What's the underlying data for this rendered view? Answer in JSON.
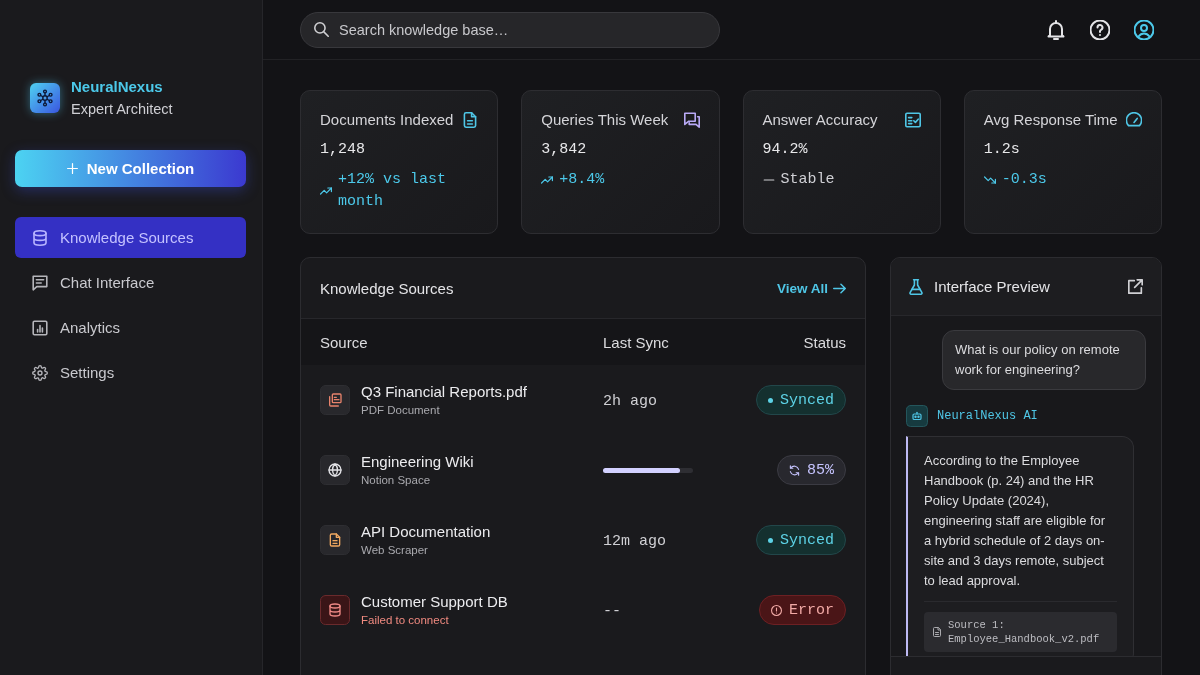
{
  "sidebar": {
    "brand": {
      "name": "NeuralNexus",
      "subtitle": "Expert Architect"
    },
    "new_button": {
      "label": "New Collection"
    },
    "nav": [
      {
        "label": "Knowledge Sources",
        "selected": true
      },
      {
        "label": "Chat Interface",
        "selected": false
      },
      {
        "label": "Analytics",
        "selected": false
      },
      {
        "label": "Settings",
        "selected": false
      }
    ]
  },
  "topbar": {
    "search": {
      "placeholder": "Search knowledge base…"
    }
  },
  "stats": [
    {
      "title": "Documents Indexed",
      "value": "1,248",
      "change": "+12% vs last month",
      "kind": "up"
    },
    {
      "title": "Queries This Week",
      "value": "3,842",
      "change": "+8.4%",
      "kind": "up"
    },
    {
      "title": "Answer Accuracy",
      "value": "94.2%",
      "change": "Stable",
      "kind": "flat"
    },
    {
      "title": "Avg Response Time",
      "value": "1.2s",
      "change": "-0.3s",
      "kind": "down"
    }
  ],
  "knowledge_sources": {
    "title": "Knowledge Sources",
    "view_all": "View All",
    "columns": [
      "Source",
      "Last Sync",
      "Status"
    ],
    "rows": [
      {
        "name": "Q3 Financial Reports.pdf",
        "type": "PDF Document",
        "last_sync": "2h ago",
        "status": {
          "kind": "synced",
          "label": "Synced"
        }
      },
      {
        "name": "Engineering Wiki",
        "type": "Notion Space",
        "sync_progress": {
          "level": 0.85
        },
        "status": {
          "kind": "syncing",
          "label": "85%"
        }
      },
      {
        "name": "API Documentation",
        "type": "Web Scraper",
        "last_sync": "12m ago",
        "status": {
          "kind": "synced",
          "label": "Synced"
        }
      },
      {
        "name": "Customer Support DB",
        "type": "Failed to connect",
        "last_sync": "--",
        "status": {
          "kind": "error",
          "label": "Error"
        }
      }
    ]
  },
  "preview": {
    "title": "Interface Preview",
    "messages": [
      {
        "kind": "user",
        "text": "What is our policy on remote work for engineering?"
      },
      {
        "kind": "assistant",
        "sender": "NeuralNexus AI",
        "text": "According to the Employee Handbook (p. 24) and the HR Policy Update (2024), engineering staff are eligible for a hybrid schedule of 2 days on-site and 3 days remote, subject to lead approval.",
        "sources": [
          {
            "label": "Source 1:",
            "file": "Employee_Handbook_v2.pdf"
          }
        ]
      }
    ]
  }
}
